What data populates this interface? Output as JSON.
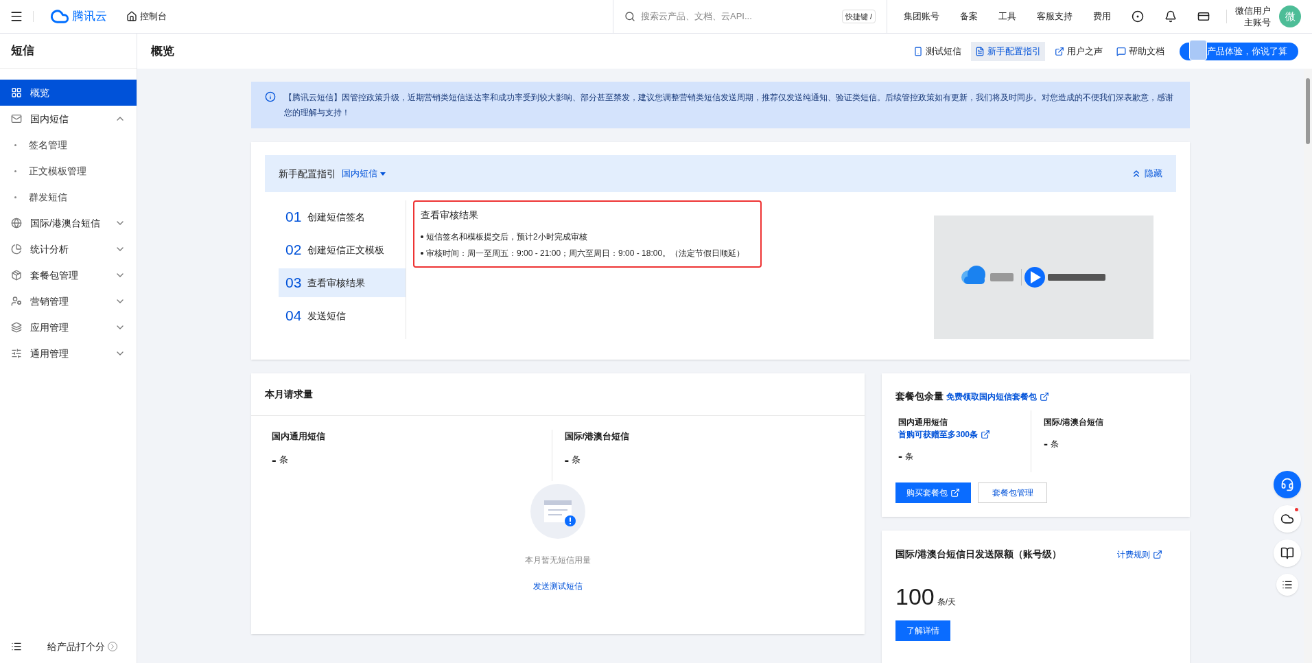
{
  "topbar": {
    "logo": "腾讯云",
    "console": "控制台",
    "search": {
      "placeholder": "搜索云产品、文档、云API...",
      "shortcut": "快捷键 /"
    },
    "nav": [
      "集团账号",
      "备案",
      "工具",
      "客服支持",
      "费用"
    ],
    "user": {
      "name": "微信用户",
      "account": "主账号",
      "avatar": "微"
    }
  },
  "sidebar": {
    "title": "短信",
    "items": [
      {
        "label": "概览",
        "selected": true,
        "expanded": false
      },
      {
        "label": "国内短信",
        "selected": false,
        "expanded": true,
        "children": [
          {
            "label": "签名管理",
            "selected": false
          },
          {
            "label": "正文模板管理",
            "selected": false
          },
          {
            "label": "群发短信",
            "selected": false
          }
        ]
      },
      {
        "label": "国际/港澳台短信",
        "selected": false,
        "expanded": false
      },
      {
        "label": "统计分析",
        "selected": false,
        "expanded": false
      },
      {
        "label": "套餐包管理",
        "selected": false,
        "expanded": false
      },
      {
        "label": "营销管理",
        "selected": false,
        "expanded": false
      },
      {
        "label": "应用管理",
        "selected": false,
        "expanded": false
      },
      {
        "label": "通用管理",
        "selected": false,
        "expanded": false
      }
    ],
    "footer": "给产品打个分"
  },
  "header": {
    "title": "概览",
    "actions": [
      {
        "label": "测试短信",
        "selected": false
      },
      {
        "label": "新手配置指引",
        "selected": true
      },
      {
        "label": "用户之声",
        "selected": false
      },
      {
        "label": "帮助文档",
        "selected": false
      }
    ],
    "promo": "产品体验，你说了算"
  },
  "notice": "【腾讯云短信】因管控政策升级，近期营销类短信送达率和成功率受到较大影响、部分甚至禁发，建议您调整营销类短信发送周期，推荐仅发送纯通知、验证类短信。后续管控政策如有更新，我们将及时同步。对您造成的不便我们深表歉意，感谢您的理解与支持！",
  "guide": {
    "title": "新手配置指引",
    "product": "国内短信",
    "hide": "隐藏",
    "steps": [
      {
        "number": "01",
        "label": "创建短信签名",
        "selected": false
      },
      {
        "number": "02",
        "label": "创建短信正文模板",
        "selected": false
      },
      {
        "number": "03",
        "label": "查看审核结果",
        "selected": true
      },
      {
        "number": "04",
        "label": "发送短信",
        "selected": false
      }
    ],
    "detail": {
      "title": "查看审核结果",
      "bullets": [
        "短信签名和模板提交后，预计2小时完成审核",
        "审核时间：周一至周五：9:00 - 21:00；周六至周日：9:00 - 18:00。（法定节假日顺延）"
      ]
    }
  },
  "requests": {
    "title": "本月请求量",
    "stats": [
      {
        "label": "国内通用短信",
        "value": "-",
        "unit": "条"
      },
      {
        "label": "国际/港澳台短信",
        "value": "-",
        "unit": "条"
      }
    ],
    "empty": "本月暂无短信用量",
    "link": "发送测试短信"
  },
  "package": {
    "title": "套餐包余量",
    "link": "免费领取国内短信套餐包",
    "stats": [
      {
        "label": "国内通用短信",
        "promo": "首购可获赠至多300条",
        "value": "-",
        "unit": "条"
      },
      {
        "label": "国际/港澳台短信",
        "value": "-",
        "unit": "条"
      }
    ],
    "buttons": [
      {
        "label": "购买套餐包",
        "kind": "primary"
      },
      {
        "label": "套餐包管理",
        "kind": "secondary"
      }
    ]
  },
  "limit": {
    "title": "国际/港澳台短信日发送限额（账号级）",
    "link": "计费规则",
    "value": "100",
    "unit": "条/天",
    "button": "了解详情"
  }
}
